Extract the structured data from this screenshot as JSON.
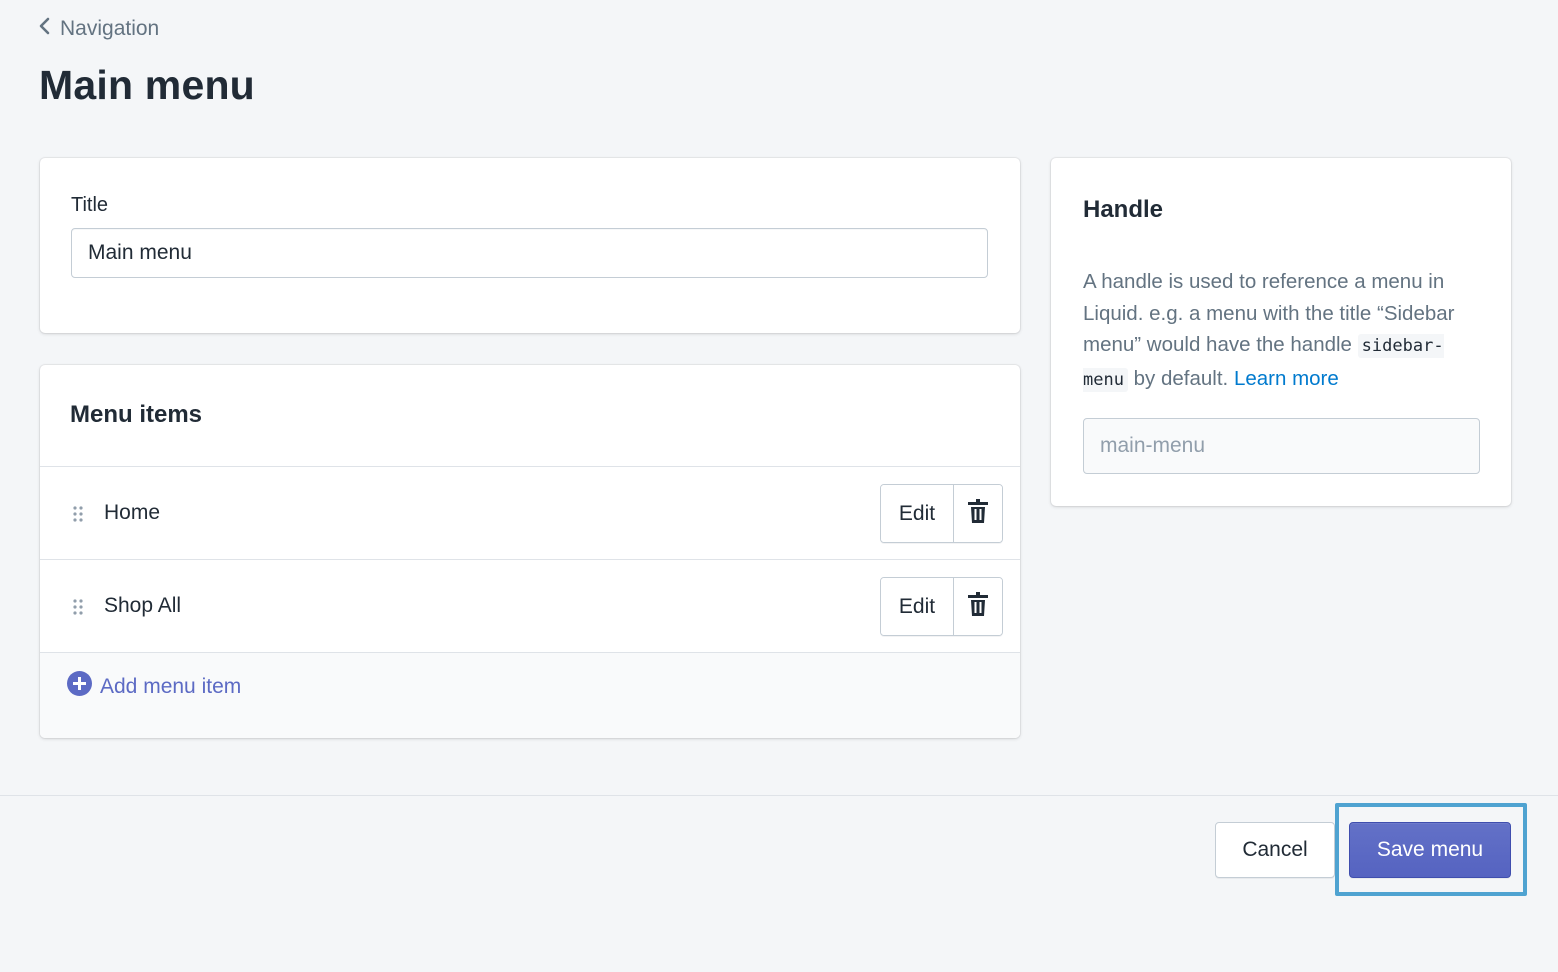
{
  "breadcrumb": {
    "label": "Navigation",
    "icon": "chevron-left-icon"
  },
  "page": {
    "title": "Main menu"
  },
  "title_card": {
    "label": "Title",
    "value": "Main menu"
  },
  "menu_items": {
    "heading": "Menu items",
    "items": [
      {
        "label": "Home",
        "edit_label": "Edit"
      },
      {
        "label": "Shop All",
        "edit_label": "Edit"
      }
    ],
    "add_label": "Add menu item"
  },
  "handle": {
    "heading": "Handle",
    "desc_1": "A handle is used to reference a menu in Liquid. e.g. a menu with the title “Sidebar menu” would have the handle ",
    "code": "sidebar-menu",
    "desc_2": " by default. ",
    "learn_more": "Learn more",
    "input_placeholder": "main-menu"
  },
  "footer": {
    "cancel_label": "Cancel",
    "save_label": "Save menu"
  },
  "colors": {
    "background": "#f4f6f8",
    "primary": "#5c6ac4",
    "link": "#007ace",
    "highlight": "#4fa3d1"
  }
}
